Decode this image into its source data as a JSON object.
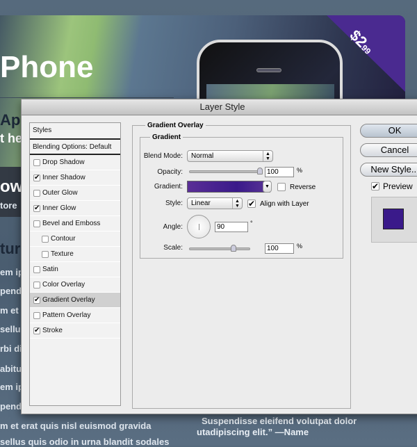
{
  "background": {
    "hero_title": "Phone",
    "price": "$2",
    "price_cents": "99",
    "left_fragments": [
      "Ap",
      "t he",
      "ow",
      "tore",
      "tur",
      "em ip",
      "pend",
      "m et",
      "sellu",
      "rbi di",
      "abitu",
      "em ip",
      "pend"
    ],
    "bottom_lines": [
      "m et erat quis nisl euismod gravida",
      "sellus quis odio in urna blandit sodales"
    ],
    "quote_lines": [
      "Suspendisse eleifend volutpat dolor",
      "utadipiscing elit.” —Name"
    ]
  },
  "dialog": {
    "title": "Layer Style",
    "styles_header": "Styles",
    "blending": "Blending Options: Default",
    "items": [
      {
        "label": "Drop Shadow",
        "checked": false
      },
      {
        "label": "Inner Shadow",
        "checked": true
      },
      {
        "label": "Outer Glow",
        "checked": false
      },
      {
        "label": "Inner Glow",
        "checked": true
      },
      {
        "label": "Bevel and Emboss",
        "checked": false
      },
      {
        "label": "Contour",
        "checked": false,
        "sub": true
      },
      {
        "label": "Texture",
        "checked": false,
        "sub": true
      },
      {
        "label": "Satin",
        "checked": false
      },
      {
        "label": "Color Overlay",
        "checked": false
      },
      {
        "label": "Gradient Overlay",
        "checked": true,
        "selected": true
      },
      {
        "label": "Pattern Overlay",
        "checked": false
      },
      {
        "label": "Stroke",
        "checked": true
      }
    ],
    "panel": {
      "section": "Gradient Overlay",
      "group": "Gradient",
      "blend_mode_label": "Blend Mode:",
      "blend_mode": "Normal",
      "opacity_label": "Opacity:",
      "opacity": "100",
      "opacity_unit": "%",
      "gradient_label": "Gradient:",
      "gradient_colors": [
        "#5a2e96",
        "#3a1a8a",
        "#5a3496"
      ],
      "reverse_label": "Reverse",
      "reverse": false,
      "style_label": "Style:",
      "style": "Linear",
      "align_label": "Align with Layer",
      "align": true,
      "angle_label": "Angle:",
      "angle": "90",
      "angle_unit": "°",
      "scale_label": "Scale:",
      "scale": "100",
      "scale_unit": "%"
    },
    "buttons": {
      "ok": "OK",
      "cancel": "Cancel",
      "new_style": "New Style...",
      "preview": "Preview"
    },
    "preview_checked": true,
    "preview_color": "#3a1a8a"
  }
}
